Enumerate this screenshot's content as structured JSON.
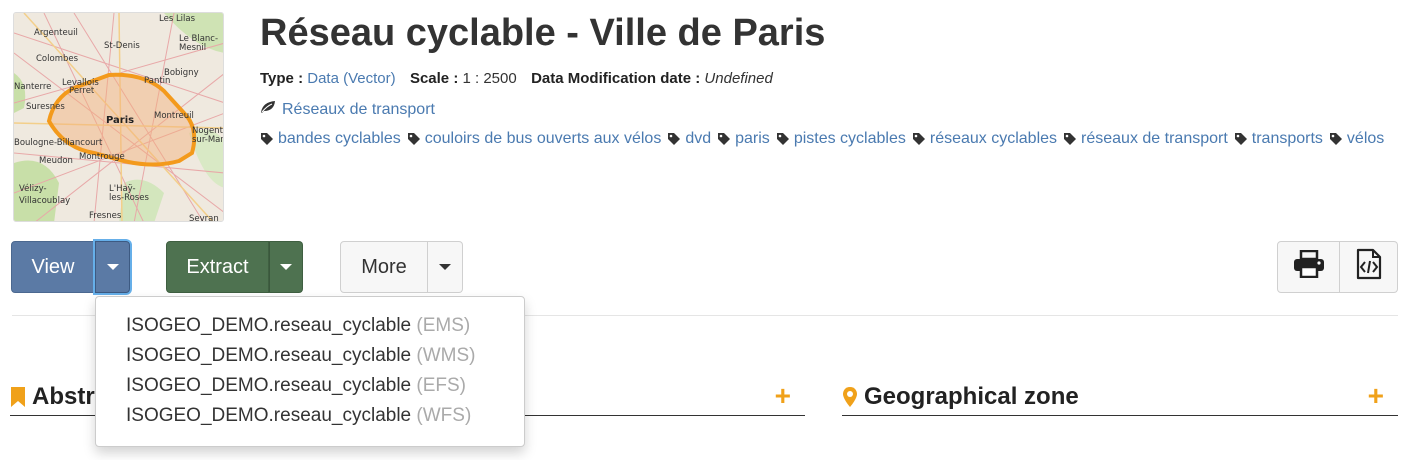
{
  "thumbnail": {
    "place_labels": [
      "Argenteuil",
      "St-Denis",
      "Colombes",
      "Le Blanc-Mesnil",
      "Bobigny",
      "Levallois-Perret",
      "Pantin",
      "Paris",
      "Montreuil",
      "Suresnes",
      "Boulogne-Billancourt",
      "Nogent-sur-Marne",
      "Meudon",
      "Montrouge",
      "L'Haÿ-les-Roses",
      "Vélizy-Villacoublay",
      "Fresnes",
      "Nanterre",
      "Les Lilas",
      "Sevran"
    ]
  },
  "header": {
    "title": "Réseau cyclable - Ville de Paris",
    "type_label": "Type :",
    "type_value": "Data (Vector)",
    "scale_label": "Scale :",
    "scale_value": "1 : 2500",
    "mod_label": "Data Modification date :",
    "mod_value": "Undefined"
  },
  "theme": {
    "label": "Réseaux de transport",
    "icon": "leaf-icon"
  },
  "tags": [
    "bandes cyclables",
    "couloirs de bus ouverts aux vélos",
    "dvd",
    "paris",
    "pistes cyclables",
    "réseaux cyclables",
    "réseaux de transport",
    "transports",
    "vélos"
  ],
  "toolbar": {
    "view_label": "View",
    "extract_label": "Extract",
    "more_label": "More",
    "print_icon": "print-icon",
    "code_icon": "file-code-icon",
    "view_color": "#5b7aa5",
    "extract_color": "#4e7250"
  },
  "dropdown": {
    "items": [
      {
        "name": "ISOGEO_DEMO.reseau_cyclable",
        "protocol": "(EMS)"
      },
      {
        "name": "ISOGEO_DEMO.reseau_cyclable",
        "protocol": "(WMS)"
      },
      {
        "name": "ISOGEO_DEMO.reseau_cyclable",
        "protocol": "(EFS)"
      },
      {
        "name": "ISOGEO_DEMO.reseau_cyclable",
        "protocol": "(WFS)"
      }
    ]
  },
  "sections": {
    "abstract_title": "Abstract",
    "geo_title": "Geographical zone",
    "plus": "+",
    "accent_color": "#f0a11a"
  }
}
